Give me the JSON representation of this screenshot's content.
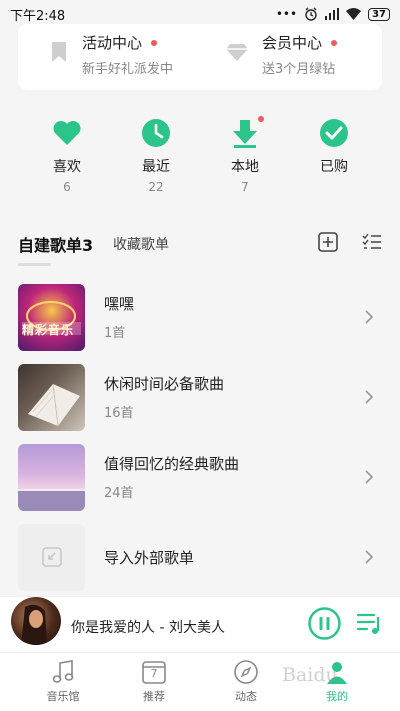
{
  "status_bar": {
    "time": "下午2:48",
    "icons": [
      "more-icon",
      "alarm-icon",
      "signal-icon",
      "wifi-icon"
    ],
    "battery": "37"
  },
  "promo": [
    {
      "title": "活动中心",
      "subtitle": "新手好礼派发中",
      "icon": "bookmark-icon"
    },
    {
      "title": "会员中心",
      "subtitle": "送3个月绿钻",
      "icon": "diamond-icon"
    }
  ],
  "quick": [
    {
      "label": "喜欢",
      "count": "6",
      "icon": "heart-icon"
    },
    {
      "label": "最近",
      "count": "22",
      "icon": "clock-icon"
    },
    {
      "label": "本地",
      "count": "7",
      "icon": "download-icon"
    },
    {
      "label": "已购",
      "count": "",
      "icon": "check-icon"
    }
  ],
  "tabs": {
    "active": "自建歌单3",
    "inactive": "收藏歌单"
  },
  "playlists": [
    {
      "name": "嘿嘿",
      "count": "1首",
      "cover_text": "精彩音乐"
    },
    {
      "name": "休闲时间必备歌曲",
      "count": "16首"
    },
    {
      "name": "值得回忆的经典歌曲",
      "count": "24首"
    },
    {
      "name": "导入外部歌单",
      "count": ""
    }
  ],
  "player": {
    "now_playing": "你是我爱的人 - 刘大美人"
  },
  "nav": [
    {
      "label": "音乐馆",
      "icon": "music-note-icon"
    },
    {
      "label": "推荐",
      "icon": "calendar-icon",
      "icon_text": "7"
    },
    {
      "label": "动态",
      "icon": "compass-icon"
    },
    {
      "label": "我的",
      "icon": "profile-icon"
    }
  ],
  "watermark": "Baidu",
  "colors": {
    "accent": "#2bc48a",
    "badge": "#f05a5a"
  }
}
